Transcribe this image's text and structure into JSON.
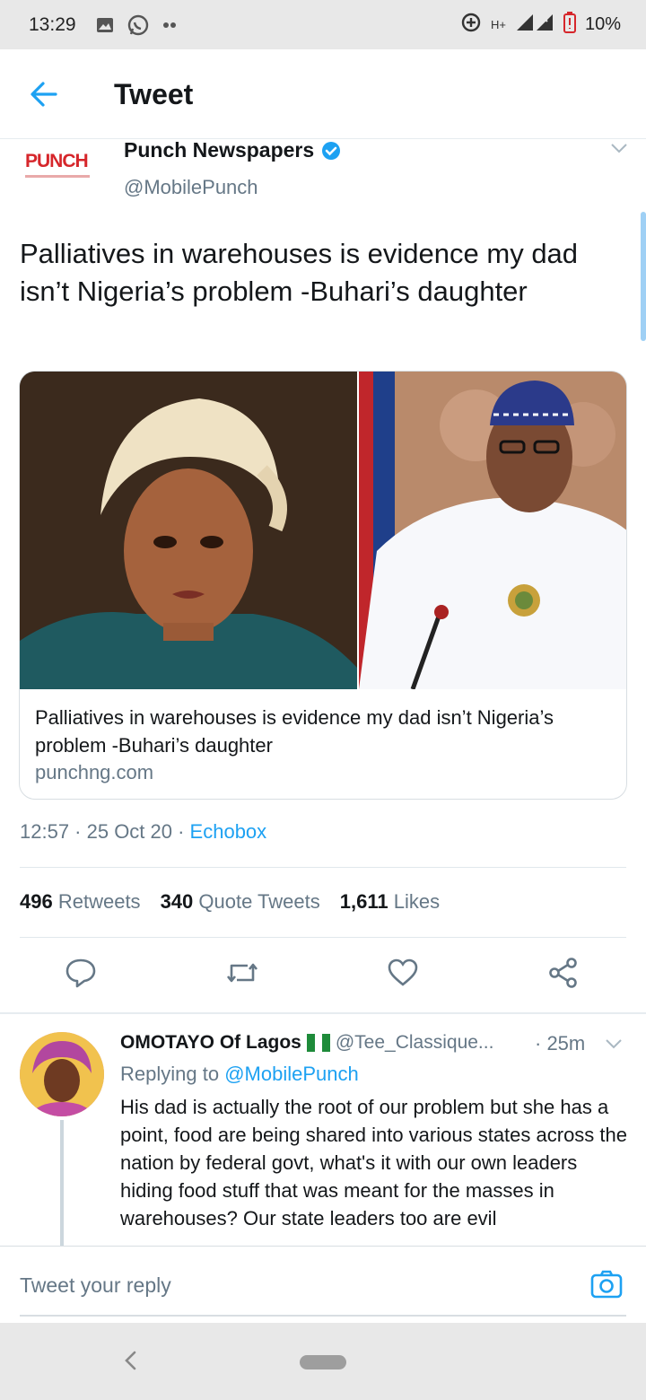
{
  "status_bar": {
    "time": "13:29",
    "network": "H+",
    "battery": "10%"
  },
  "header": {
    "title": "Tweet"
  },
  "tweet": {
    "logo_text": "PUNCH",
    "author_name": "Punch Newspapers",
    "author_handle": "@MobilePunch",
    "text": "Palliatives in warehouses is evidence my dad isn’t Nigeria’s problem -Buhari’s daughter",
    "card": {
      "title": "Palliatives in warehouses is evidence my dad isn’t Nigeria’s problem -Buhari’s daughter",
      "domain": "punchng.com"
    },
    "meta": {
      "time_date": "12:57 · 25 Oct 20 · ",
      "source": "Echobox"
    },
    "stats": {
      "retweets_count": "496",
      "retweets_label": "Retweets",
      "quotes_count": "340",
      "quotes_label": "Quote Tweets",
      "likes_count": "1,611",
      "likes_label": "Likes"
    }
  },
  "reply": {
    "name": "OMOTAYO Of Lagos",
    "handle": "@Tee_Classique...",
    "time": "· 25m",
    "replying_prefix": "Replying to ",
    "replying_to": "@MobilePunch",
    "text": "His dad is actually the root of our problem but she has a point, food are being shared into various states across the nation by federal govt, what's it with our own leaders hiding food stuff that was meant for the masses in warehouses? Our state leaders too are evil"
  },
  "composer": {
    "placeholder": "Tweet your reply"
  },
  "colors": {
    "accent": "#1da1f2",
    "secondary_text": "#657786",
    "punch_red": "#d6262b"
  }
}
